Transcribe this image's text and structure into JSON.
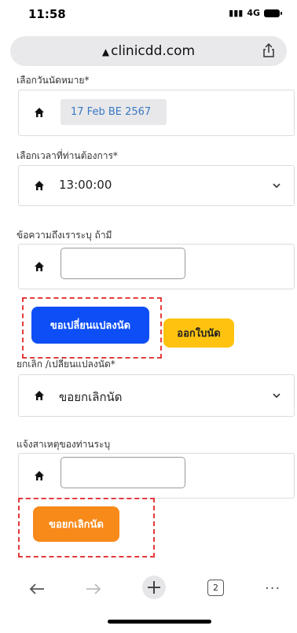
{
  "status_bar": {
    "time": "11:58",
    "network": "4G"
  },
  "browser": {
    "domain": "clinicdd.com"
  },
  "form": {
    "date_label": "เลือกวันนัดหมาย*",
    "date_value": "17 Feb BE 2567",
    "time_label": "เลือกเวลาที่ท่านต้องการ*",
    "time_value": "13:00:00",
    "message_label": "ข้อความถึงเราระบุ ถ้ามี",
    "message_value": "",
    "change_button": "ขอเปลี่ยนแปลงนัด",
    "card_button": "ออกใบนัด",
    "cancel_type_label": "ยกเลิก /เปลี่ยนแปลงนัด*",
    "cancel_type_value": "ขอยกเลิกนัด",
    "reason_label": "แจ้งสาเหตุของท่านระบุ",
    "reason_value": "",
    "cancel_button": "ขอยกเลิกนัด"
  },
  "toolbar": {
    "tab_count": "2"
  },
  "colors": {
    "blue_button": "#0d4ef6",
    "yellow_button": "#ffc30f",
    "orange_button": "#f88a1a",
    "highlight_dash": "#e43b3b",
    "date_text": "#3a79c3"
  },
  "icons": [
    "home-icon",
    "chevron-down-icon",
    "share-icon",
    "back-arrow-icon",
    "forward-arrow-icon",
    "new-tab-plus-icon",
    "tabs-icon",
    "more-icon"
  ]
}
